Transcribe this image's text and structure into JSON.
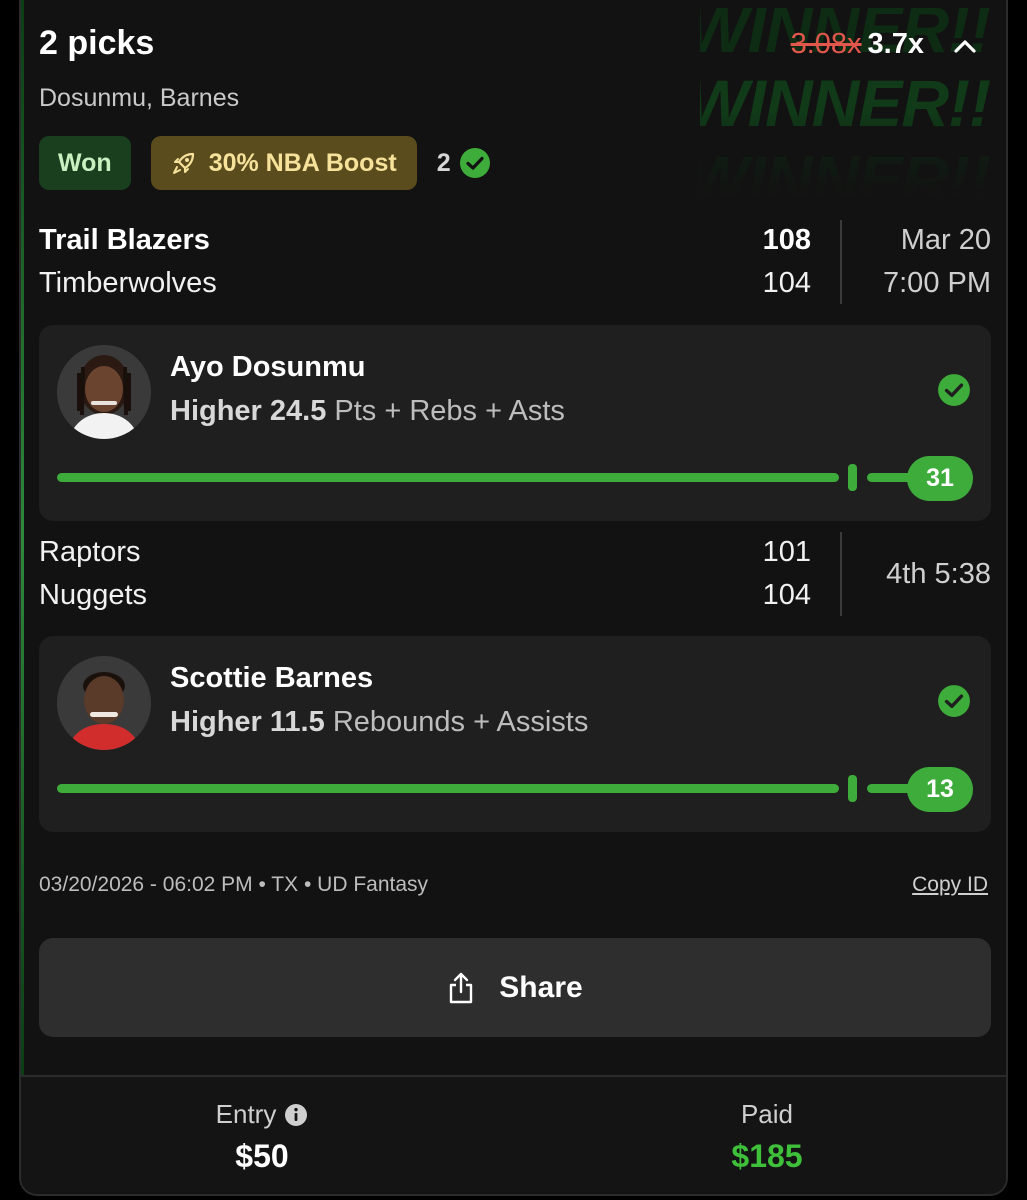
{
  "header": {
    "title": "2 picks",
    "subtitle": "Dosunmu, Barnes",
    "old_multiplier": "3.08x",
    "new_multiplier": "3.7x",
    "background_text": "WINNER!!"
  },
  "badges": {
    "status": "Won",
    "boost": "30% NBA Boost",
    "correct_count": "2"
  },
  "games": [
    {
      "team1": "Trail Blazers",
      "score1": "108",
      "team2": "Timberwolves",
      "score2": "104",
      "info1": "Mar 20",
      "info2": "7:00 PM"
    },
    {
      "team1": "Raptors",
      "score1": "101",
      "team2": "Nuggets",
      "score2": "104",
      "info": "4th 5:38"
    }
  ],
  "picks": [
    {
      "player": "Ayo Dosunmu",
      "direction_line": "Higher 24.5",
      "stat": "Pts + Rebs + Asts",
      "result": "31"
    },
    {
      "player": "Scottie Barnes",
      "direction_line": "Higher 11.5",
      "stat": "Rebounds + Assists",
      "result": "13"
    }
  ],
  "meta": {
    "text": "03/20/2026 - 06:02 PM • TX • UD Fantasy",
    "copy_id": "Copy ID"
  },
  "share_label": "Share",
  "footer": {
    "entry_label": "Entry",
    "entry_value": "$50",
    "paid_label": "Paid",
    "paid_value": "$185"
  },
  "colors": {
    "accent_green": "#3eac3a",
    "won_bg": "#1a3f1f",
    "boost_bg": "#5b4c1e",
    "strike_red": "#e2574c"
  }
}
